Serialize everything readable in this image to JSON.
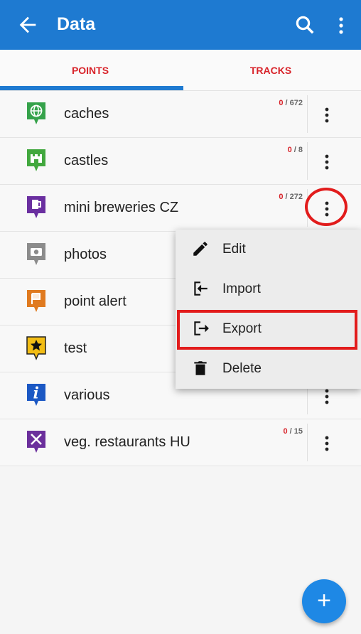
{
  "appbar": {
    "title": "Data",
    "color": "#1e7ad1"
  },
  "tabs": [
    {
      "label": "POINTS",
      "selected": true
    },
    {
      "label": "TRACKS",
      "selected": false
    }
  ],
  "items": [
    {
      "name": "caches",
      "count_zero": "0",
      "count_total": "/ 672",
      "icon": "globe-pin-icon",
      "color": "#35a24a"
    },
    {
      "name": "castles",
      "count_zero": "0",
      "count_total": "/ 8",
      "icon": "castle-pin-icon",
      "color": "#42a83e"
    },
    {
      "name": "mini breweries CZ",
      "count_zero": "0",
      "count_total": "/ 272",
      "icon": "beer-pin-icon",
      "color": "#6a2fa0"
    },
    {
      "name": "photos",
      "icon": "camera-pin-icon",
      "color": "#8c8c8c"
    },
    {
      "name": "point alert",
      "icon": "flag-pin-icon",
      "color": "#e07a1f"
    },
    {
      "name": "test",
      "icon": "star-pin-icon",
      "color": "#f2bd15"
    },
    {
      "name": "various",
      "icon": "info-pin-icon",
      "color": "#1b58c4"
    },
    {
      "name": "veg. restaurants HU",
      "count_zero": "0",
      "count_total": "/ 15",
      "icon": "restaurant-pin-icon",
      "color": "#6b2f9c"
    }
  ],
  "menu": {
    "items": [
      {
        "label": "Edit",
        "icon": "pencil-icon"
      },
      {
        "label": "Import",
        "icon": "import-icon"
      },
      {
        "label": "Export",
        "icon": "export-icon"
      },
      {
        "label": "Delete",
        "icon": "trash-icon"
      }
    ]
  },
  "fab": {
    "label": "+"
  },
  "colors": {
    "accent": "#1e7ad1",
    "alert": "#d8232a",
    "highlight": "#e21c1c"
  }
}
